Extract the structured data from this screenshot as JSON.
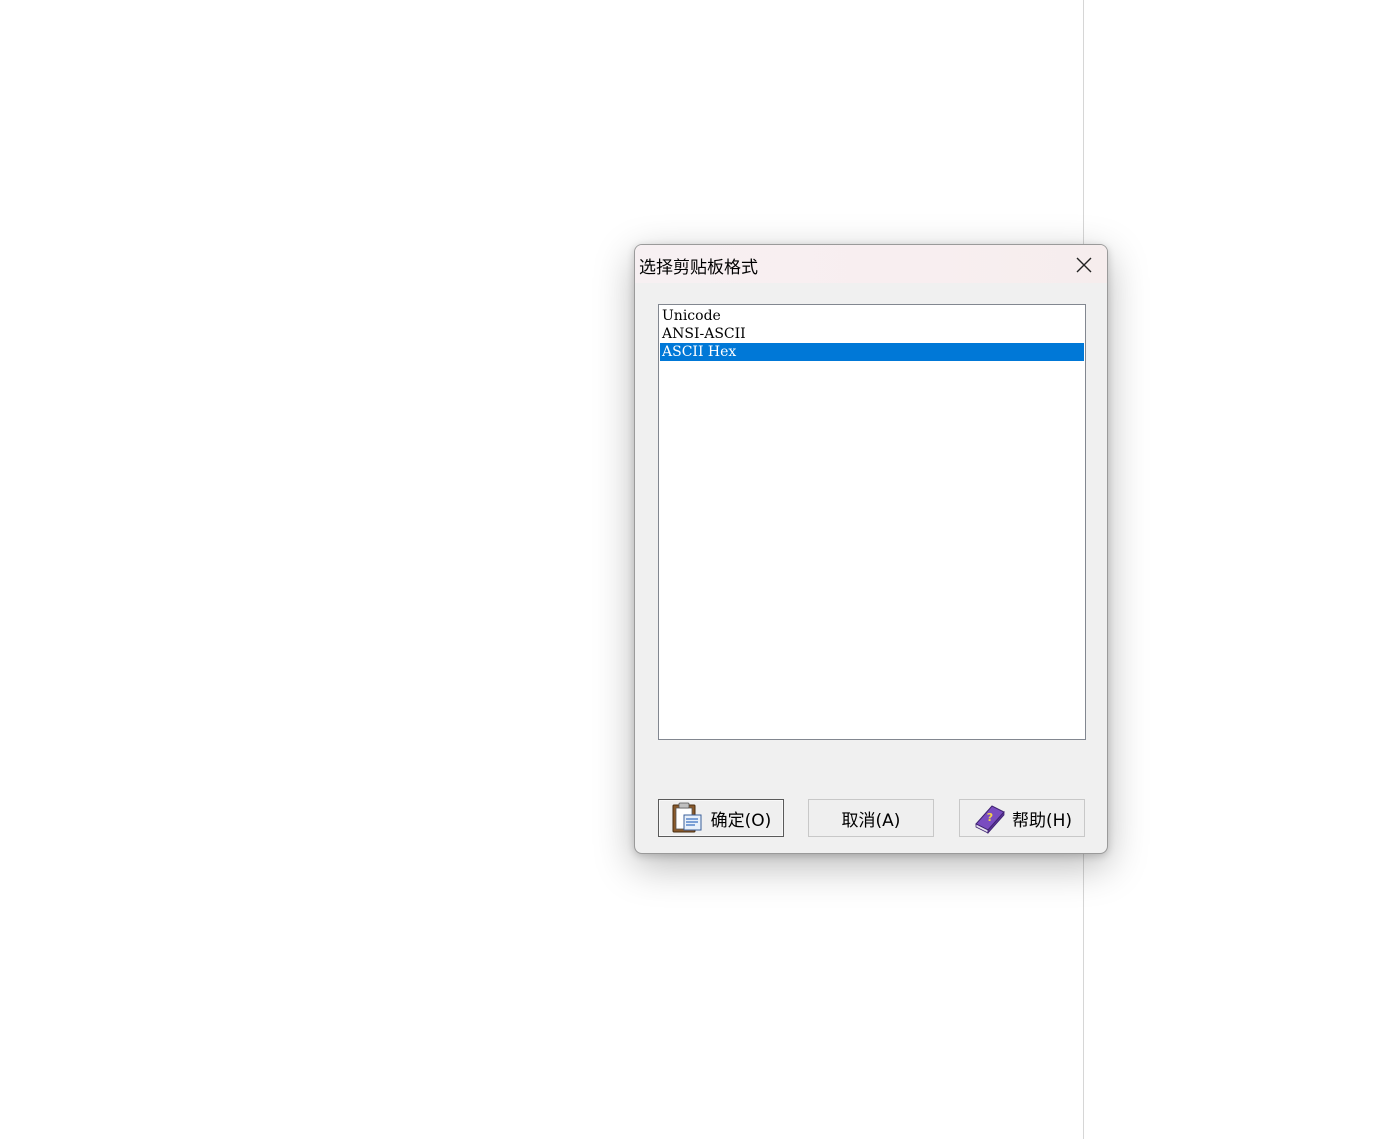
{
  "dialog": {
    "title": "选择剪贴板格式",
    "close_icon": "close-icon"
  },
  "format_list": {
    "items": [
      "Unicode",
      "ANSI-ASCII",
      "ASCII Hex"
    ],
    "selected": "ASCII Hex"
  },
  "buttons": {
    "ok_label": "确定(O)",
    "ok_icon": "clipboard-icon",
    "cancel_label": "取消(A)",
    "help_label": "帮助(H)",
    "help_icon": "help-book-icon"
  },
  "colors": {
    "selection": "#0078d7",
    "dialog_bg": "#f0f0f0",
    "help_book": "#6b3fa0"
  }
}
